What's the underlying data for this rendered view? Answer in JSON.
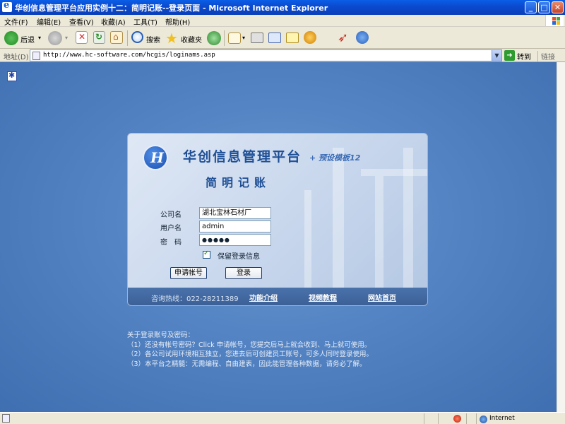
{
  "window": {
    "title": "华创信息管理平台应用实例十二：简明记账--登录页面 - Microsoft Internet Explorer",
    "controls": {
      "minimize": "_",
      "maximize": "□",
      "close": "✕"
    }
  },
  "menu": {
    "items": [
      {
        "label": "文件(F)"
      },
      {
        "label": "编辑(E)"
      },
      {
        "label": "查看(V)"
      },
      {
        "label": "收藏(A)"
      },
      {
        "label": "工具(T)"
      },
      {
        "label": "帮助(H)"
      }
    ]
  },
  "toolbar": {
    "back_label": "后退",
    "search_label": "搜索",
    "favorites_label": "收藏夹"
  },
  "address": {
    "label": "地址(D)",
    "url": "http://www.hc-software.com/hcgis/loginams.asp",
    "go_label": "转到",
    "links_label": "链接"
  },
  "login": {
    "platform_title": "华创信息管理平台",
    "template_tag": "+ 预设模板12",
    "subtitle": "简明记账",
    "company_label": "公司名",
    "company_value": "湖北宝林石材厂",
    "username_label": "用户名",
    "username_value": "admin",
    "password_label": "密　码",
    "password_value": "●●●●●",
    "remember_label": "保留登录信息",
    "remember_checked": true,
    "apply_button": "申请帐号",
    "login_button": "登录",
    "hotline": "咨询热线：022-28211389",
    "links": [
      "功能介绍",
      "视频教程",
      "网站首页"
    ]
  },
  "notes": {
    "heading": "关于登录账号及密码：",
    "lines": [
      "（1）还没有帐号密码？Click 申请帐号，您提交后马上就会收到、马上就可使用。",
      "（2）各公司试用环境相互独立，您进去后可创建员工账号，可多人同时登录使用。",
      "（3）本平台之精髓：无需编程、自由建表，因此能管理各种数据，请务必了解。"
    ]
  },
  "status": {
    "zone": "Internet"
  },
  "colors": {
    "titlebar": "#0b4bd0",
    "content_bg": "#5585c4",
    "panel_title": "#1e4f96",
    "footer_bg": "#3a5f96"
  }
}
